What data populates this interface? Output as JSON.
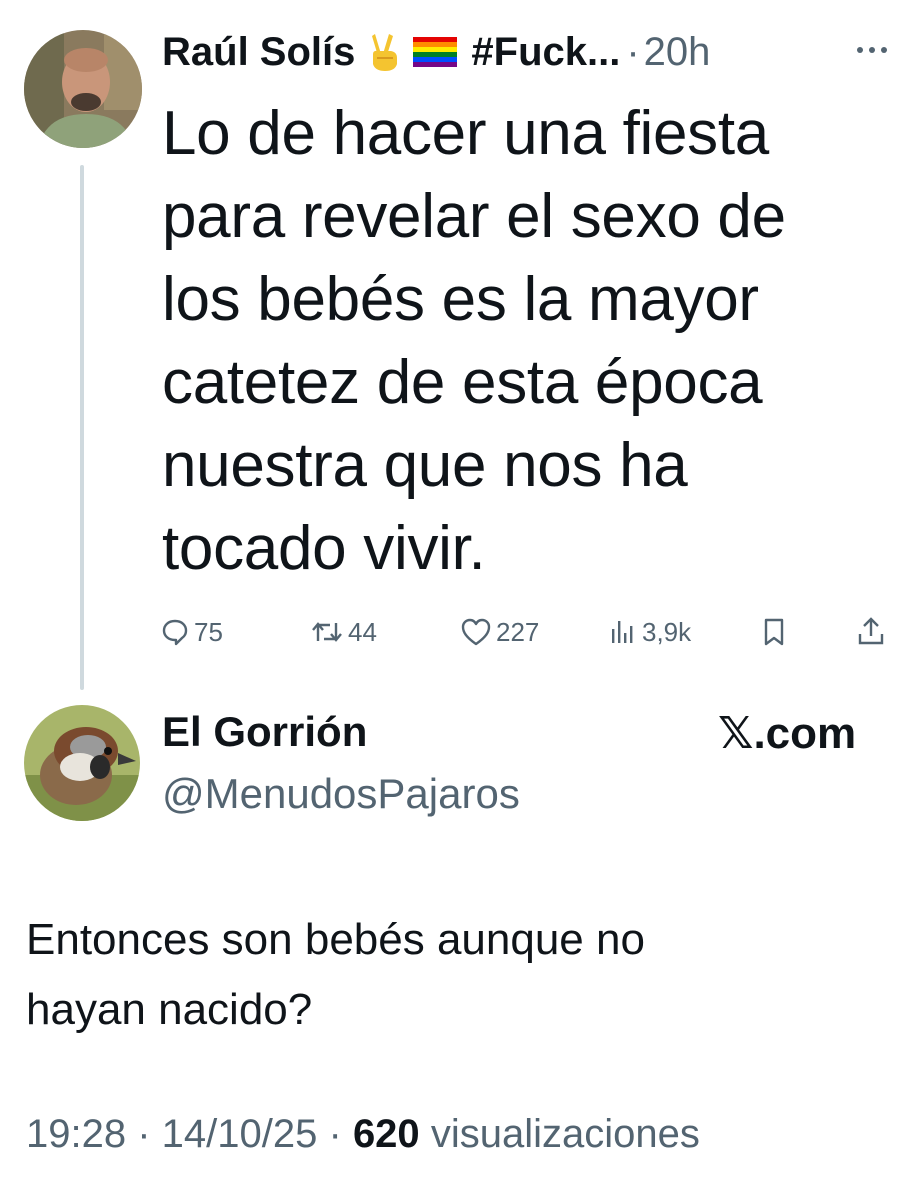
{
  "original_tweet": {
    "author_name": "Raúl Solís",
    "hashtag": "#Fuck...",
    "time_ago": "20h",
    "text_lines": [
      "Lo de hacer una fiesta",
      "para revelar el sexo de",
      "los bebés es la mayor",
      "catetez de esta época",
      "nuestra que nos ha",
      "tocado vivir."
    ],
    "stats": {
      "replies": "75",
      "retweets": "44",
      "likes": "227",
      "views": "3,9k"
    },
    "icons": [
      "victory-hand-emoji",
      "rainbow-flag-emoji",
      "more-icon",
      "reply-icon",
      "retweet-icon",
      "like-icon",
      "views-icon",
      "bookmark-icon",
      "share-icon"
    ]
  },
  "reply_tweet": {
    "author_name": "El Gorrión",
    "handle": "@MenudosPajaros",
    "source": "𝕏.com",
    "text_lines": [
      "Entonces son bebés aunque no",
      "hayan nacido?"
    ],
    "time": "19:28",
    "date": "14/10/25",
    "views_count": "620",
    "views_label": "visualizaciones"
  },
  "colors": {
    "text": "#0f1419",
    "muted": "#536471",
    "thread_line": "#cfd9de"
  }
}
